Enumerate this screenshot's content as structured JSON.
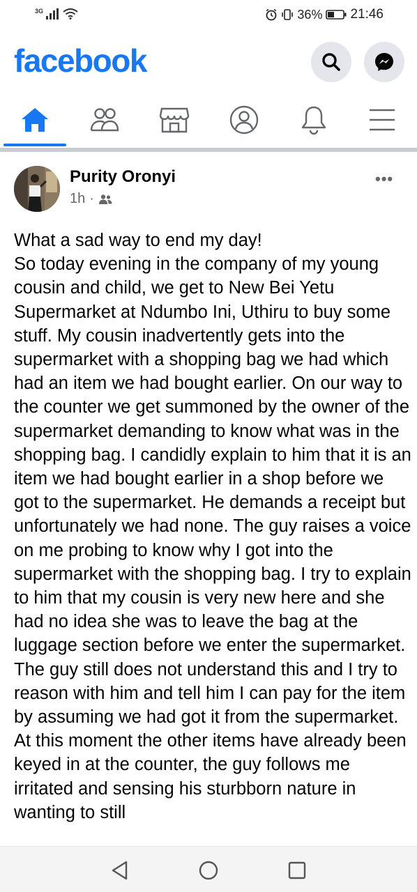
{
  "status_bar": {
    "network": "3G",
    "battery": "36%",
    "time": "21:46"
  },
  "header": {
    "logo": "facebook",
    "icons": [
      "search-icon",
      "messenger-icon"
    ]
  },
  "nav": {
    "tabs": [
      {
        "name": "home",
        "icon": "home-icon",
        "active": true
      },
      {
        "name": "friends",
        "icon": "friends-icon",
        "active": false
      },
      {
        "name": "marketplace",
        "icon": "marketplace-icon",
        "active": false
      },
      {
        "name": "profile",
        "icon": "profile-icon",
        "active": false
      },
      {
        "name": "notifications",
        "icon": "bell-icon",
        "active": false
      },
      {
        "name": "menu",
        "icon": "menu-icon",
        "active": false
      }
    ]
  },
  "post": {
    "author": "Purity Oronyi",
    "time": "1h",
    "separator": "·",
    "audience_icon": "friends-audience-icon",
    "more": "•••",
    "text": "What a sad way to end my day!\nSo today evening in the company of my young cousin and child, we get to New Bei Yetu Supermarket at Ndumbo Ini, Uthiru to buy some stuff. My cousin inadvertently gets into the supermarket with a shopping bag we had which had an item we had bought earlier. On our way to the counter we get summoned by the owner of the supermarket demanding to know what was in the shopping bag. I candidly explain to him that it is an item we had bought earlier in a shop before we got to the supermarket. He demands a receipt but unfortunately we had none. The guy raises a voice on me probing to know why I got into the supermarket with the shopping bag. I try to explain to him that my cousin is very new here and she had no idea she was to leave the bag at the luggage section before we enter the supermarket. The guy still does not understand this and I try to reason with him and tell him I can pay for the item by assuming we had got it from the supermarket. At this moment the other items have already been keyed in at the counter, the guy follows me irritated and sensing his sturbborn nature in wanting to still"
  },
  "colors": {
    "brand": "#1877f2",
    "icon_grey": "#65676b",
    "divider": "#c9ccd1"
  }
}
